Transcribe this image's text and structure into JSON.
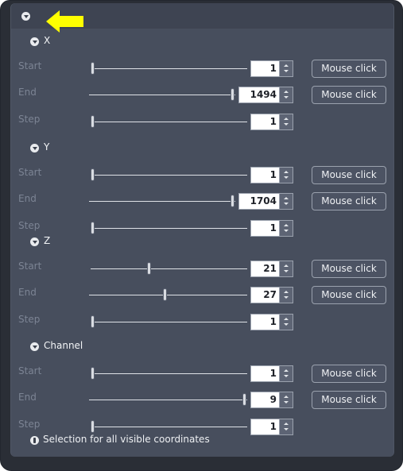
{
  "header": {
    "collapse_icon": "collapse-icon"
  },
  "sections": [
    {
      "id": "x",
      "title": "X",
      "rows": [
        {
          "label": "Start",
          "value": "1",
          "slider_fraction": 0.0,
          "button": "Mouse click"
        },
        {
          "label": "End",
          "value": "1494",
          "slider_fraction": 1.0,
          "button": "Mouse click"
        },
        {
          "label": "Step",
          "value": "1",
          "slider_fraction": 0.0,
          "button": null
        }
      ]
    },
    {
      "id": "y",
      "title": "Y",
      "rows": [
        {
          "label": "Start",
          "value": "1",
          "slider_fraction": 0.0,
          "button": "Mouse click"
        },
        {
          "label": "End",
          "value": "1704",
          "slider_fraction": 1.0,
          "button": "Mouse click"
        },
        {
          "label": "Step",
          "value": "1",
          "slider_fraction": 0.0,
          "button": null
        }
      ]
    },
    {
      "id": "z",
      "title": "Z",
      "rows": [
        {
          "label": "Start",
          "value": "21",
          "slider_fraction": 0.37,
          "button": "Mouse click"
        },
        {
          "label": "End",
          "value": "27",
          "slider_fraction": 0.48,
          "button": "Mouse click"
        },
        {
          "label": "Step",
          "value": "1",
          "slider_fraction": 0.0,
          "button": null
        }
      ]
    },
    {
      "id": "channel",
      "title": "Channel",
      "rows": [
        {
          "label": "Start",
          "value": "1",
          "slider_fraction": 0.0,
          "button": "Mouse click"
        },
        {
          "label": "End",
          "value": "9",
          "slider_fraction": 1.0,
          "button": "Mouse click"
        },
        {
          "label": "Step",
          "value": "1",
          "slider_fraction": 0.0,
          "button": null
        }
      ]
    }
  ],
  "footer": {
    "text": "Selection for all visible coordinates",
    "icon": "info-icon"
  },
  "colors": {
    "panel": "#474e5d",
    "frame": "#2a2e36",
    "arrow": "#ffff00",
    "label_muted": "#7c8494"
  }
}
